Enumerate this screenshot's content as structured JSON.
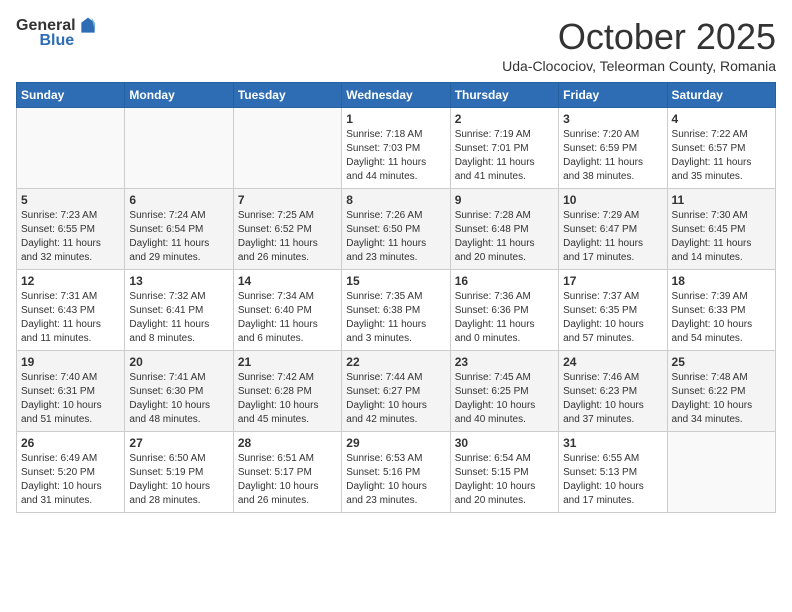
{
  "header": {
    "logo_general": "General",
    "logo_blue": "Blue",
    "month_title": "October 2025",
    "subtitle": "Uda-Clocociov, Teleorman County, Romania"
  },
  "days_of_week": [
    "Sunday",
    "Monday",
    "Tuesday",
    "Wednesday",
    "Thursday",
    "Friday",
    "Saturday"
  ],
  "weeks": [
    [
      {
        "day": "",
        "info": ""
      },
      {
        "day": "",
        "info": ""
      },
      {
        "day": "",
        "info": ""
      },
      {
        "day": "1",
        "info": "Sunrise: 7:18 AM\nSunset: 7:03 PM\nDaylight: 11 hours\nand 44 minutes."
      },
      {
        "day": "2",
        "info": "Sunrise: 7:19 AM\nSunset: 7:01 PM\nDaylight: 11 hours\nand 41 minutes."
      },
      {
        "day": "3",
        "info": "Sunrise: 7:20 AM\nSunset: 6:59 PM\nDaylight: 11 hours\nand 38 minutes."
      },
      {
        "day": "4",
        "info": "Sunrise: 7:22 AM\nSunset: 6:57 PM\nDaylight: 11 hours\nand 35 minutes."
      }
    ],
    [
      {
        "day": "5",
        "info": "Sunrise: 7:23 AM\nSunset: 6:55 PM\nDaylight: 11 hours\nand 32 minutes."
      },
      {
        "day": "6",
        "info": "Sunrise: 7:24 AM\nSunset: 6:54 PM\nDaylight: 11 hours\nand 29 minutes."
      },
      {
        "day": "7",
        "info": "Sunrise: 7:25 AM\nSunset: 6:52 PM\nDaylight: 11 hours\nand 26 minutes."
      },
      {
        "day": "8",
        "info": "Sunrise: 7:26 AM\nSunset: 6:50 PM\nDaylight: 11 hours\nand 23 minutes."
      },
      {
        "day": "9",
        "info": "Sunrise: 7:28 AM\nSunset: 6:48 PM\nDaylight: 11 hours\nand 20 minutes."
      },
      {
        "day": "10",
        "info": "Sunrise: 7:29 AM\nSunset: 6:47 PM\nDaylight: 11 hours\nand 17 minutes."
      },
      {
        "day": "11",
        "info": "Sunrise: 7:30 AM\nSunset: 6:45 PM\nDaylight: 11 hours\nand 14 minutes."
      }
    ],
    [
      {
        "day": "12",
        "info": "Sunrise: 7:31 AM\nSunset: 6:43 PM\nDaylight: 11 hours\nand 11 minutes."
      },
      {
        "day": "13",
        "info": "Sunrise: 7:32 AM\nSunset: 6:41 PM\nDaylight: 11 hours\nand 8 minutes."
      },
      {
        "day": "14",
        "info": "Sunrise: 7:34 AM\nSunset: 6:40 PM\nDaylight: 11 hours\nand 6 minutes."
      },
      {
        "day": "15",
        "info": "Sunrise: 7:35 AM\nSunset: 6:38 PM\nDaylight: 11 hours\nand 3 minutes."
      },
      {
        "day": "16",
        "info": "Sunrise: 7:36 AM\nSunset: 6:36 PM\nDaylight: 11 hours\nand 0 minutes."
      },
      {
        "day": "17",
        "info": "Sunrise: 7:37 AM\nSunset: 6:35 PM\nDaylight: 10 hours\nand 57 minutes."
      },
      {
        "day": "18",
        "info": "Sunrise: 7:39 AM\nSunset: 6:33 PM\nDaylight: 10 hours\nand 54 minutes."
      }
    ],
    [
      {
        "day": "19",
        "info": "Sunrise: 7:40 AM\nSunset: 6:31 PM\nDaylight: 10 hours\nand 51 minutes."
      },
      {
        "day": "20",
        "info": "Sunrise: 7:41 AM\nSunset: 6:30 PM\nDaylight: 10 hours\nand 48 minutes."
      },
      {
        "day": "21",
        "info": "Sunrise: 7:42 AM\nSunset: 6:28 PM\nDaylight: 10 hours\nand 45 minutes."
      },
      {
        "day": "22",
        "info": "Sunrise: 7:44 AM\nSunset: 6:27 PM\nDaylight: 10 hours\nand 42 minutes."
      },
      {
        "day": "23",
        "info": "Sunrise: 7:45 AM\nSunset: 6:25 PM\nDaylight: 10 hours\nand 40 minutes."
      },
      {
        "day": "24",
        "info": "Sunrise: 7:46 AM\nSunset: 6:23 PM\nDaylight: 10 hours\nand 37 minutes."
      },
      {
        "day": "25",
        "info": "Sunrise: 7:48 AM\nSunset: 6:22 PM\nDaylight: 10 hours\nand 34 minutes."
      }
    ],
    [
      {
        "day": "26",
        "info": "Sunrise: 6:49 AM\nSunset: 5:20 PM\nDaylight: 10 hours\nand 31 minutes."
      },
      {
        "day": "27",
        "info": "Sunrise: 6:50 AM\nSunset: 5:19 PM\nDaylight: 10 hours\nand 28 minutes."
      },
      {
        "day": "28",
        "info": "Sunrise: 6:51 AM\nSunset: 5:17 PM\nDaylight: 10 hours\nand 26 minutes."
      },
      {
        "day": "29",
        "info": "Sunrise: 6:53 AM\nSunset: 5:16 PM\nDaylight: 10 hours\nand 23 minutes."
      },
      {
        "day": "30",
        "info": "Sunrise: 6:54 AM\nSunset: 5:15 PM\nDaylight: 10 hours\nand 20 minutes."
      },
      {
        "day": "31",
        "info": "Sunrise: 6:55 AM\nSunset: 5:13 PM\nDaylight: 10 hours\nand 17 minutes."
      },
      {
        "day": "",
        "info": ""
      }
    ]
  ]
}
